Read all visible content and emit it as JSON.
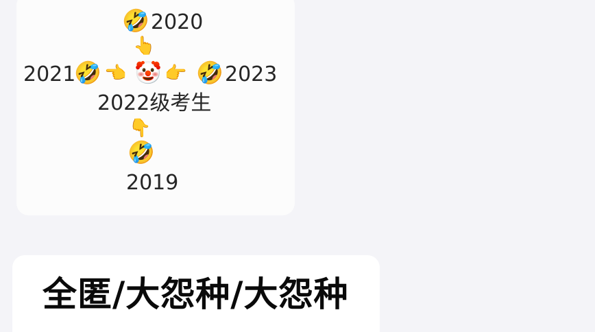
{
  "messages": [
    {
      "type": "image",
      "meme": {
        "year_top": "2020",
        "year_left": "2021",
        "year_right": "2023",
        "year_bottom": "2019",
        "center_caption": "2022级考生",
        "center_emoji": "🤡",
        "laugh_emoji": "🤣",
        "hand_up": "👆",
        "hand_down": "👇",
        "hand_left": "👈",
        "hand_right": "👉"
      }
    },
    {
      "type": "text",
      "text": "全匿/大怨种/大怨种"
    }
  ]
}
